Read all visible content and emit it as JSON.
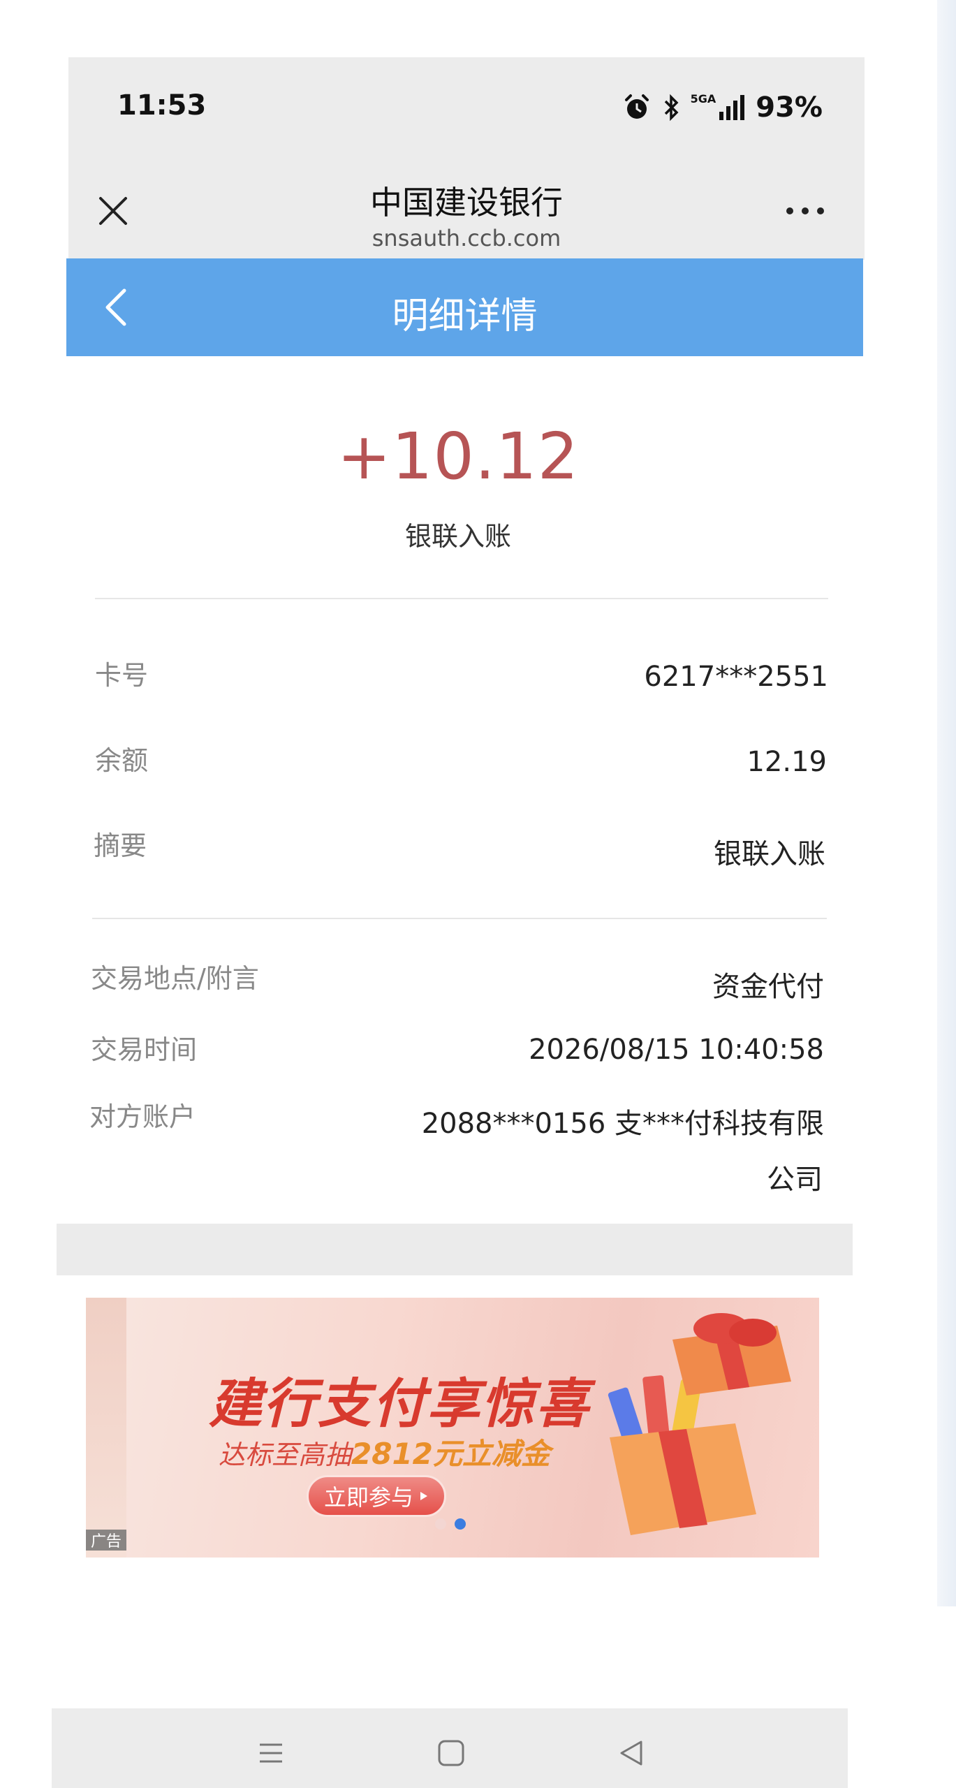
{
  "status_bar": {
    "time": "11:53",
    "network": "5GA",
    "battery": "93%"
  },
  "browser": {
    "title": "中国建设银行",
    "url": "snsauth.ccb.com"
  },
  "header": {
    "title": "明细详情"
  },
  "transaction": {
    "amount": "+10.12",
    "type": "银联入账",
    "amount_color": "#b65455",
    "details": [
      {
        "label": "卡号",
        "value": "6217***2551"
      },
      {
        "label": "余额",
        "value": "12.19"
      },
      {
        "label": "摘要",
        "value": "银联入账"
      }
    ],
    "extra": [
      {
        "label": "交易地点/附言",
        "value": "资金代付"
      },
      {
        "label": "交易时间",
        "value": "2026/08/15 10:40:58"
      },
      {
        "label": "对方账户",
        "value_line1": "2088***0156  支***付科技有限",
        "value_line2": "公司"
      }
    ]
  },
  "banner": {
    "title": "建行支付享惊喜",
    "subtitle_prefix": "达标至高抽",
    "subtitle_highlight": "2812元立减金",
    "button_label": "立即参与",
    "ad_tag": "广告"
  },
  "colors": {
    "header_bg": "#5ea5e9",
    "amount": "#b65455"
  }
}
